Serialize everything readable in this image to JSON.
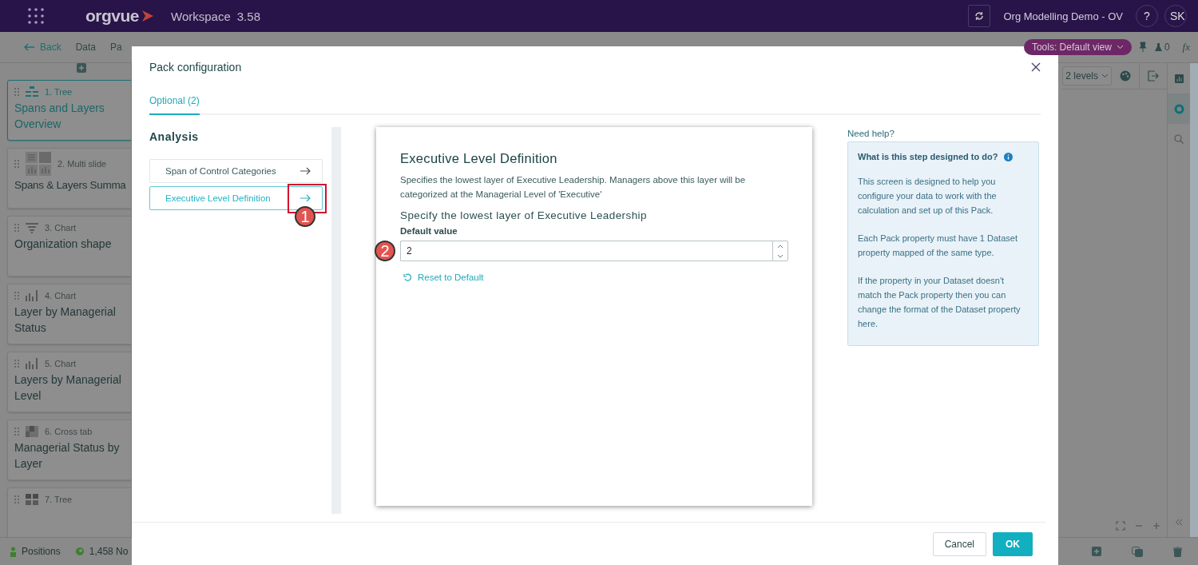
{
  "top_bar": {
    "app_name": "orgvue",
    "workspace": "Workspace",
    "version": "3.58",
    "project": "Org Modelling Demo - OV",
    "help": "?",
    "avatar": "SK"
  },
  "toolbar": {
    "back": "Back",
    "menu": [
      {
        "label": "Data"
      },
      {
        "label": "Pa"
      }
    ],
    "view_button": "Tools: Default view",
    "pin_count": "0",
    "formula": "fx"
  },
  "sidebar": {
    "items": [
      {
        "kind": "tree",
        "type_label": "1. Tree",
        "title": "Spans and Layers Overview",
        "selected": true
      },
      {
        "kind": "multi",
        "type_label": "2. Multi slide",
        "title": "Spans & Layers Summa",
        "selected": false
      },
      {
        "kind": "funnel",
        "type_label": "3. Chart",
        "title": "Organization shape",
        "selected": false
      },
      {
        "kind": "bar",
        "type_label": "4. Chart",
        "title": "Layer by Managerial Status",
        "selected": false
      },
      {
        "kind": "bar",
        "type_label": "5. Chart",
        "title": "Layers by Managerial Level",
        "selected": false
      },
      {
        "kind": "crosstab",
        "type_label": "6. Cross tab",
        "title": "Managerial Status by Layer",
        "selected": false
      },
      {
        "kind": "grid",
        "type_label": "7. Tree",
        "selected": false
      }
    ]
  },
  "canvas": {
    "levels": "2 levels"
  },
  "status_bar": {
    "items": [
      {
        "kind": "positions",
        "label": "Positions"
      },
      {
        "kind": "nodes",
        "label": "1,458 No"
      }
    ]
  },
  "modal": {
    "title": "Pack configuration",
    "tabs": [
      {
        "label": "Optional (2)",
        "selected": true
      }
    ],
    "section": "Analysis",
    "steps": [
      {
        "label": "Span of Control Categories",
        "selected": false
      },
      {
        "label": "Executive Level Definition",
        "selected": true
      }
    ],
    "step": {
      "title": "Executive Level Definition",
      "description": "Specifies the lowest layer of Executive Leadership. Managers above this layer will be categorized at the Managerial Level of 'Executive'",
      "question": "Specify the lowest layer of Executive Leadership",
      "field_label": "Default value",
      "value": "2",
      "reset": "Reset to Default"
    },
    "help": {
      "heading": "Need help?",
      "title": "What is this step designed to do?",
      "paragraphs": [
        "This screen is designed to help you configure your data to work with the calculation and set up of this Pack.",
        "Each Pack property must have 1 Dataset property mapped of the same type.",
        "If the property in your Dataset doesn't match the Pack property then you can change the format of the Dataset property here."
      ]
    },
    "buttons": [
      {
        "label": "Cancel",
        "kind": "secondary"
      },
      {
        "label": "OK",
        "kind": "primary"
      }
    ]
  },
  "annotations": [
    {
      "number": "1"
    },
    {
      "number": "2"
    }
  ]
}
